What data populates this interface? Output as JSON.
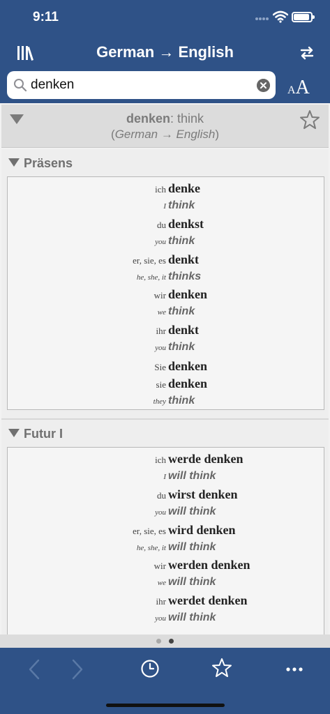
{
  "status": {
    "time": "9:11"
  },
  "nav": {
    "title": "German → English"
  },
  "search": {
    "value": "denken",
    "placeholder": ""
  },
  "entry": {
    "word": "denken",
    "separator": ":",
    "translation": " think",
    "direction_open": "(",
    "direction": "German → English",
    "direction_close": ")"
  },
  "sections": [
    {
      "title": "Präsens",
      "rows": [
        {
          "pron": "ich",
          "form": "denke"
        },
        {
          "pron_en": "I",
          "trans": "think"
        },
        {
          "pron": "du",
          "form": "denkst"
        },
        {
          "pron_en": "you",
          "trans": "think"
        },
        {
          "pron": "er, sie, es",
          "form": "denkt"
        },
        {
          "pron_en": "he, she, it",
          "trans": "thinks"
        },
        {
          "pron": "wir",
          "form": "denken"
        },
        {
          "pron_en": "we",
          "trans": "think"
        },
        {
          "pron": "ihr",
          "form": "denkt"
        },
        {
          "pron_en": "you",
          "trans": "think"
        },
        {
          "pron": "Sie",
          "form": "denken"
        },
        {
          "pron": "sie",
          "form": "denken"
        },
        {
          "pron_en": "they",
          "trans": "think"
        }
      ]
    },
    {
      "title": "Futur I",
      "rows": [
        {
          "pron": "ich",
          "form": "werde denken"
        },
        {
          "pron_en": "I",
          "trans": "will think"
        },
        {
          "pron": "du",
          "form": "wirst denken"
        },
        {
          "pron_en": "you",
          "trans": "will think"
        },
        {
          "pron": "er, sie, es",
          "form": "wird denken"
        },
        {
          "pron_en": "he, she, it",
          "trans": "will think"
        },
        {
          "pron": "wir",
          "form": "werden denken"
        },
        {
          "pron_en": "we",
          "trans": "will think"
        },
        {
          "pron": "ihr",
          "form": "werdet denken"
        },
        {
          "pron_en": "you",
          "trans": "will think"
        }
      ]
    }
  ],
  "pager": {
    "count": 2,
    "active": 1
  },
  "colors": {
    "navy": "#2f5287",
    "toolbar_icon": "#ffffff",
    "disabled_icon": "#5a79a6"
  },
  "icons": [
    "library-icon",
    "swap-icon",
    "search-icon",
    "clear-icon",
    "font-size-icon",
    "star-icon",
    "back-icon",
    "forward-icon",
    "history-icon",
    "favorites-icon",
    "more-icon"
  ],
  "font_size_icon": {
    "small": "A",
    "big": "A"
  }
}
